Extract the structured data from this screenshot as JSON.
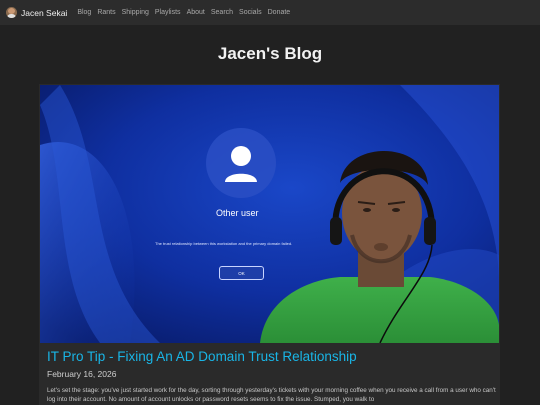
{
  "navbar": {
    "brand": "Jacen Sekai",
    "links": [
      "Blog",
      "Rants",
      "Shipping",
      "Playlists",
      "About",
      "Search",
      "Socials",
      "Donate"
    ]
  },
  "page": {
    "title": "Jacen's Blog"
  },
  "post": {
    "thumbnail": {
      "login_user": "Other user",
      "login_message": "The trust relationship between this workstation and the primary domain failed.",
      "ok_button": "OK"
    },
    "title": "IT Pro Tip - Fixing An AD Domain Trust Relationship",
    "date": "February 16, 2026",
    "excerpt": "Let's set the stage: you've just started work for the day, sorting through yesterday's tickets with your morning coffee when you receive a call from a user who can't log into their account. No amount of account unlocks or password resets seems to fix the issue. Stumped, you walk to"
  },
  "colors": {
    "link": "#19b5e6",
    "navbar": "#2c2c2c",
    "background": "#212121",
    "login_bg": "#0f2a8c"
  }
}
